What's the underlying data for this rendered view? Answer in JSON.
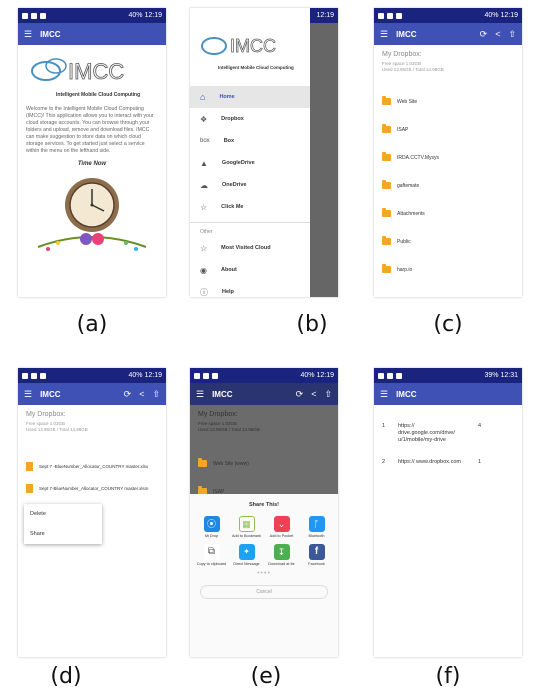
{
  "status": {
    "left_icons": "notification icons",
    "battery": "40%",
    "time": "12:19",
    "time_f": "12:31",
    "battery_f": "39%"
  },
  "app_title": "IMCC",
  "logo": {
    "text": "IMCC",
    "tagline": "Intelligent Mobile Cloud Computing",
    "small": [
      "box",
      "G"
    ]
  },
  "panel_a": {
    "welcome": "Welcome to the Intelligent Mobile Cloud Computing (IMCC)! This application allows you to interact with your cloud storage accounts. You can browse through your folders and upload, remove and download files. IMCC can make suggestion to store data on which cloud storage services. To get started just select a service within the menu on the lefthand side.",
    "time_now": "Time Now"
  },
  "panel_b": {
    "menu": [
      {
        "icon": "home-icon",
        "label": "Home"
      },
      {
        "icon": "dropbox-icon",
        "label": "Dropbox"
      },
      {
        "icon": "box-icon",
        "label": "Box"
      },
      {
        "icon": "googledrive-icon",
        "label": "GoogleDrive"
      },
      {
        "icon": "onedrive-icon",
        "label": "OneDrive"
      },
      {
        "icon": "star-icon",
        "label": "Click Me"
      }
    ],
    "section_other": "Other",
    "other": [
      {
        "icon": "star-icon",
        "label": "Most Visited Cloud"
      },
      {
        "icon": "info-icon",
        "label": "About"
      },
      {
        "icon": "help-icon",
        "label": "Help"
      }
    ]
  },
  "dropbox": {
    "title": "My Dropbox:",
    "free": "Free space 1.03GB",
    "used": "Used 13.95GB / Total 14.98GB"
  },
  "panel_c": {
    "folders": [
      "Web Site",
      "ISAP",
      "IRDA.CCTV.Mysys",
      "gaftemate",
      "Attachments",
      "Public",
      "harp.io"
    ]
  },
  "panel_d": {
    "files": [
      "Sept 7 -BlueNumber_Allocator_COUNTRY master.xlsx",
      "Sept 7-BlueNumber_Allocator_COUNTRY master.xlsm"
    ],
    "menu": [
      "Delete",
      "Share"
    ]
  },
  "panel_e": {
    "folders": [
      "Web Site (www)",
      "ISAP"
    ],
    "share_title": "Share This!",
    "apps": [
      {
        "label": "Mi Drop",
        "color": "#1e88e5"
      },
      {
        "label": "Add to Bookmark",
        "color": "#ffffff"
      },
      {
        "label": "Add to Pocket",
        "color": "#ef4056"
      },
      {
        "label": "Bluetooth",
        "color": "#2196f3"
      },
      {
        "label": "Copy to clipboard",
        "color": "#ffffff"
      },
      {
        "label": "Direct Message",
        "color": "#1da1f2"
      },
      {
        "label": "Download at Ite",
        "color": "#4caf50"
      },
      {
        "label": "Facebook",
        "color": "#3b5998"
      }
    ],
    "cancel": "Cancel"
  },
  "panel_f": {
    "rows": [
      {
        "rank": "1",
        "url": "https:// drive.google.com/drive/ u/1/mobile/my-drive",
        "count": "4"
      },
      {
        "rank": "2",
        "url": "https:// www.dropbox.com",
        "count": "1"
      }
    ]
  },
  "captions": [
    "(a)",
    "(b)",
    "(c)",
    "(d)",
    "(e)",
    "(f)"
  ]
}
